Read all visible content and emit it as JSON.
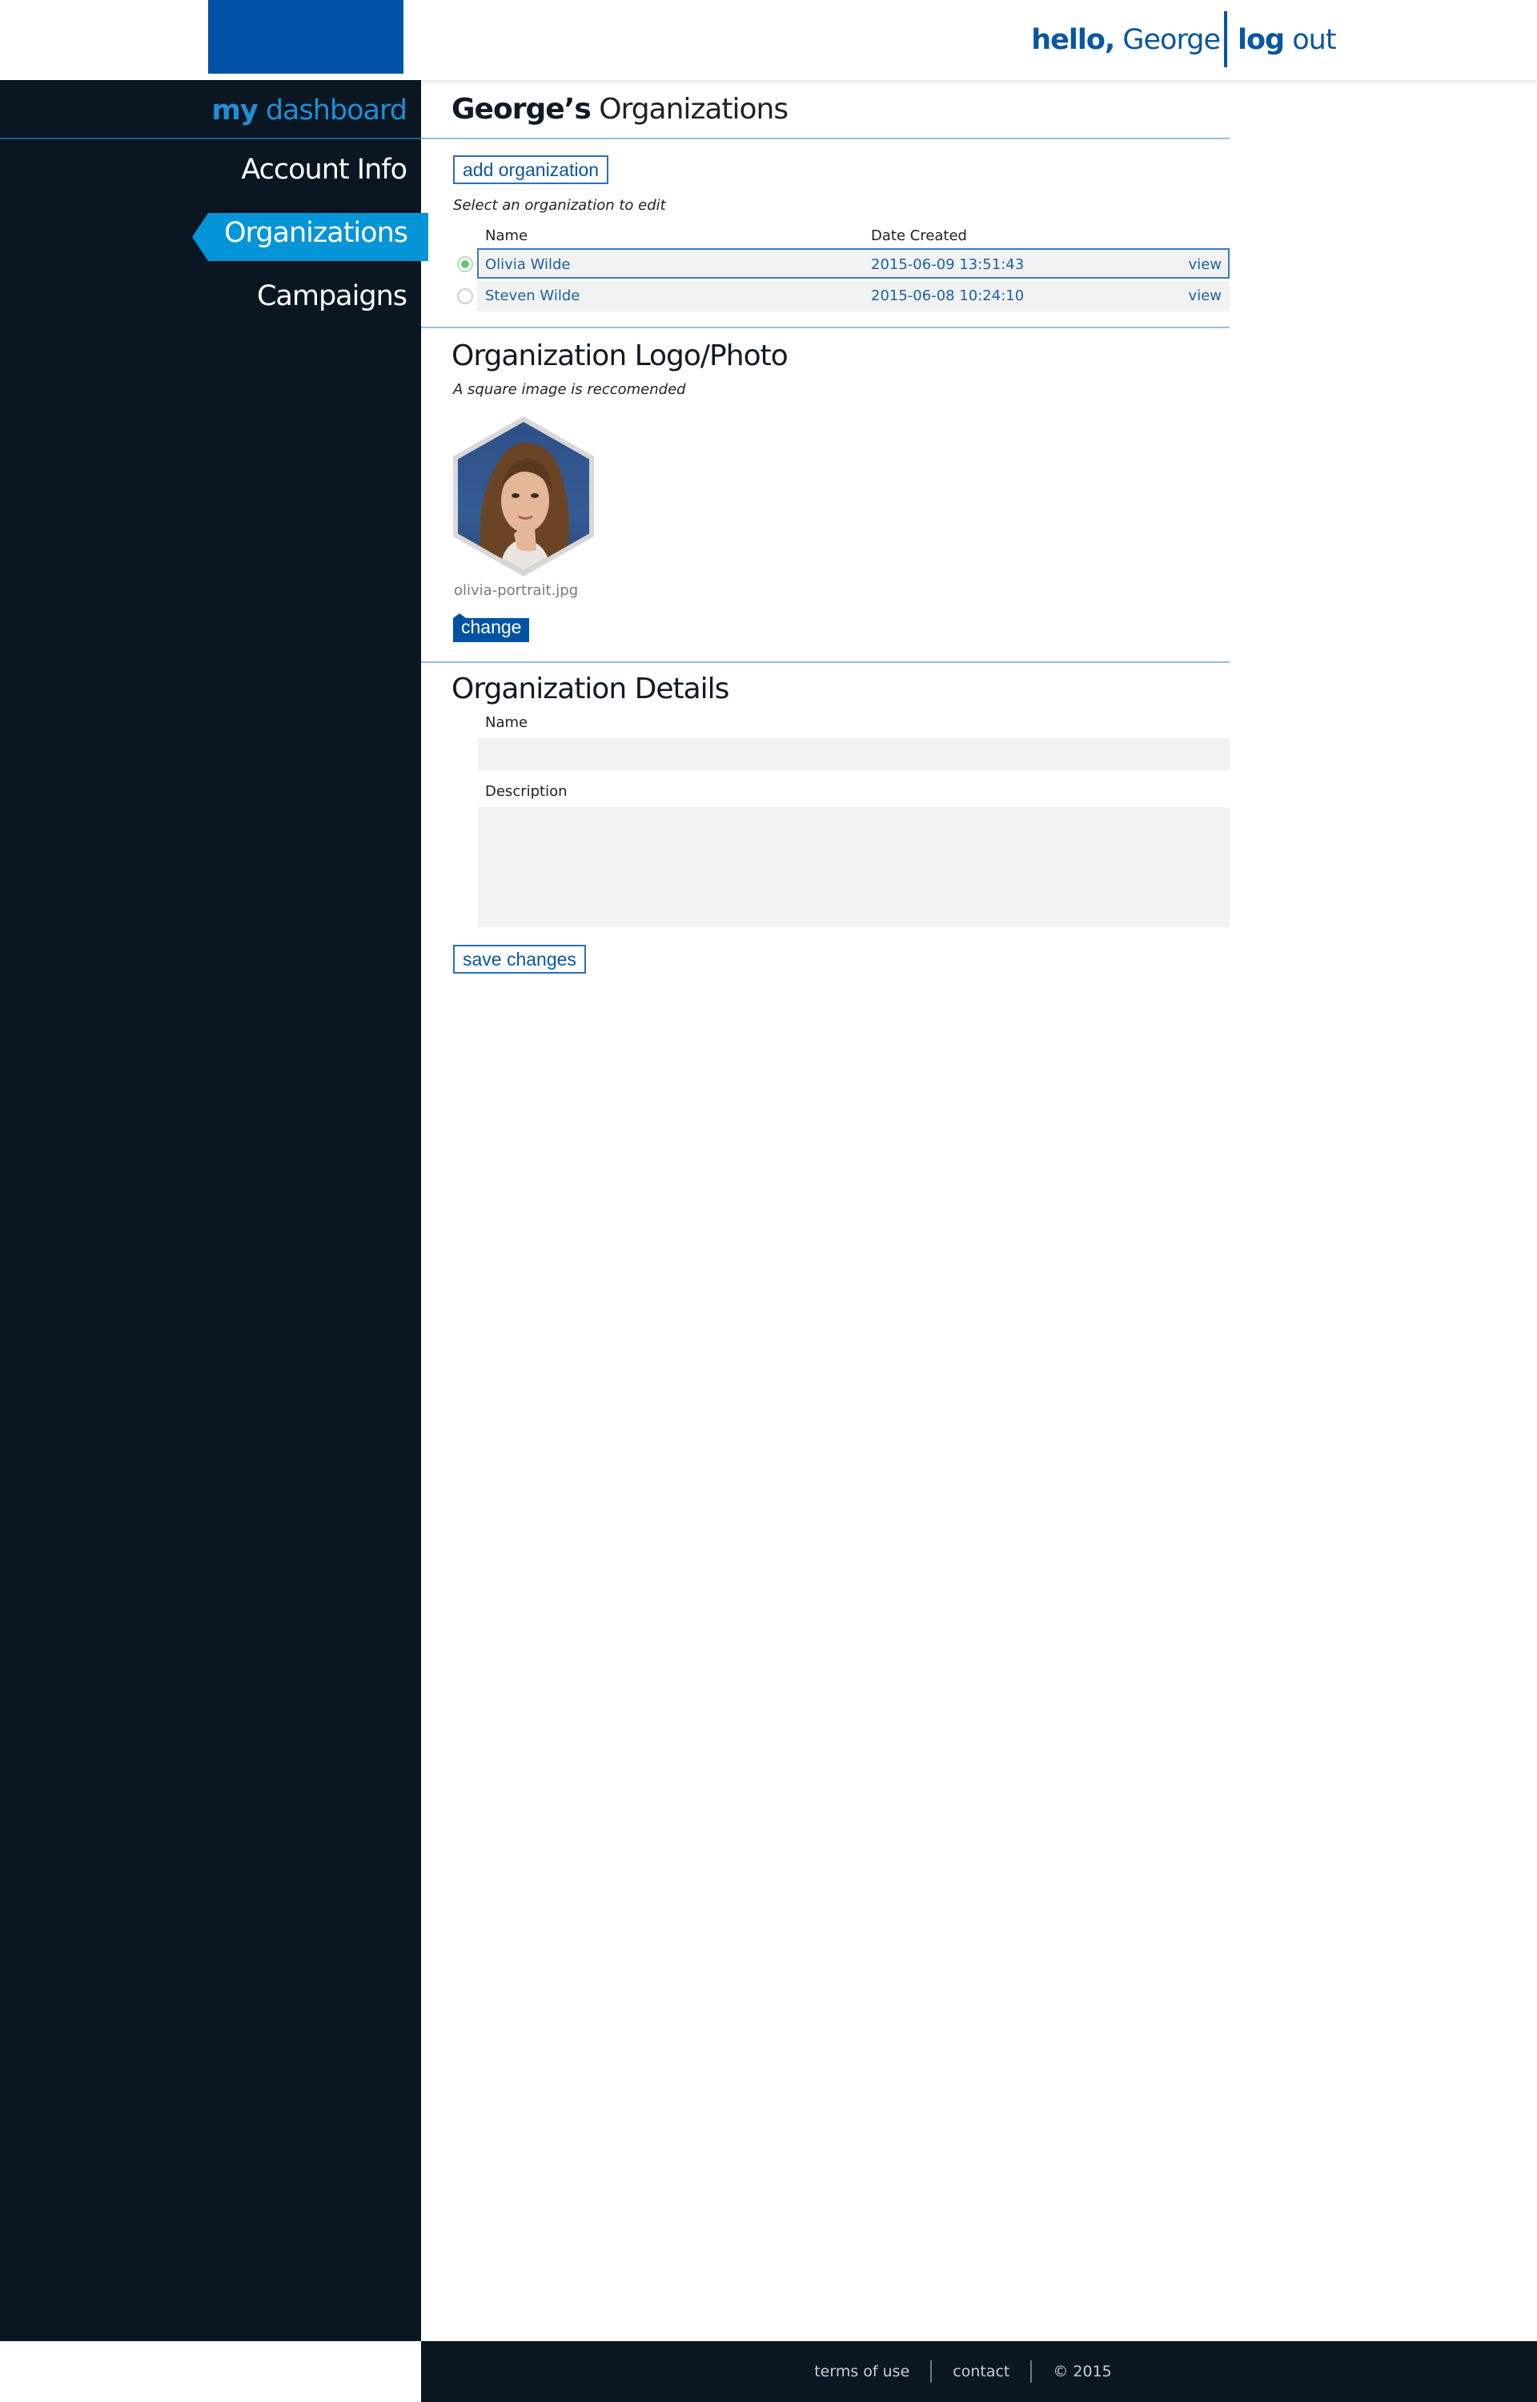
{
  "header": {
    "greeting_bold": "hello,",
    "user_name": "George",
    "logout_bold": "log",
    "logout_light": "out"
  },
  "sidebar": {
    "title_bold": "my",
    "title_light": "dashboard",
    "items": [
      {
        "label": "Account Info",
        "active": false
      },
      {
        "label": "Organizations",
        "active": true
      },
      {
        "label": "Campaigns",
        "active": false
      }
    ]
  },
  "main": {
    "title_owner": "George’s",
    "title_rest": "Organizations",
    "add_button": "add organization",
    "select_hint": "Select an organization to edit",
    "table": {
      "columns": [
        "Name",
        "Date Created"
      ],
      "rows": [
        {
          "name": "Olivia Wilde",
          "date": "2015-06-09 13:51:43",
          "action": "view",
          "selected": true
        },
        {
          "name": "Steven Wilde",
          "date": "2015-06-08 10:24:10",
          "action": "view",
          "selected": false
        }
      ]
    },
    "logo_section": {
      "heading": "Organization Logo/Photo",
      "hint": "A square image is reccomended",
      "filename": "olivia-portrait.jpg",
      "change_button": "change"
    },
    "details_section": {
      "heading": "Organization Details",
      "name_label": "Name",
      "name_value": "",
      "description_label": "Description",
      "description_value": "",
      "save_button": "save changes"
    }
  },
  "footer": {
    "terms": "terms of use",
    "contact": "contact",
    "copyright": "© 2015"
  },
  "colors": {
    "brand_blue": "#0053a4",
    "accent_blue": "#0395d8",
    "sidebar_bg": "#0a1622",
    "field_bg": "#f2f2f2",
    "radio_selected": "#6ec46e"
  }
}
